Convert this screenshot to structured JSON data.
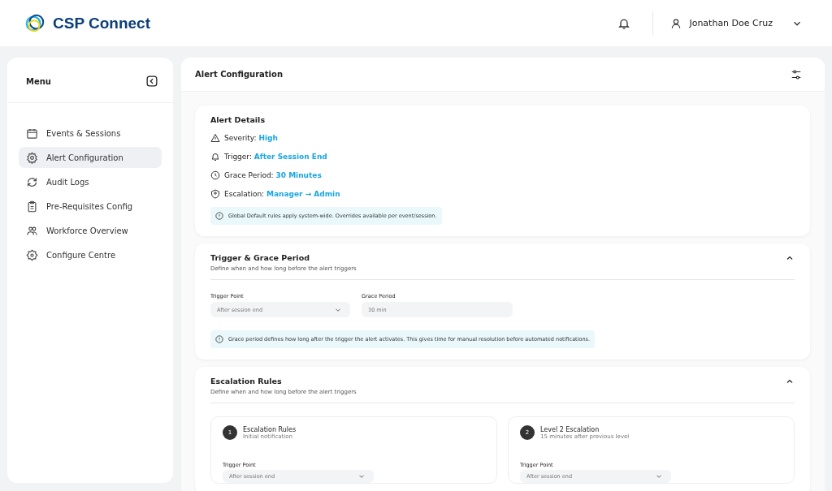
{
  "header": {
    "brand": "CSP Connect",
    "user": "Jonathan Doe Cruz"
  },
  "sidebar": {
    "title": "Menu",
    "items": [
      {
        "label": "Events & Sessions",
        "kind": "calendar",
        "selected": false
      },
      {
        "label": "Alert Configuration",
        "kind": "gear",
        "selected": true
      },
      {
        "label": "Audit Logs",
        "kind": "refresh",
        "selected": false
      },
      {
        "label": "Pre-Requisites Config",
        "kind": "clipboard",
        "selected": false
      },
      {
        "label": "Workforce Overview",
        "kind": "people",
        "selected": false
      },
      {
        "label": "Configure Centre",
        "kind": "badge",
        "selected": false
      }
    ]
  },
  "page": {
    "title": "Alert Configuration"
  },
  "alert_details": {
    "title": "Alert Details",
    "rows": [
      {
        "kind": "warning",
        "label": "Severity:",
        "value": "High"
      },
      {
        "kind": "bell",
        "label": "Trigger:",
        "value": "After Session End"
      },
      {
        "kind": "clock",
        "label": "Grace Period:",
        "value": "30 Minutes"
      },
      {
        "kind": "shield",
        "label": "Escalation:",
        "value": "Manager → Admin"
      }
    ],
    "note": "Global Default rules apply system-wide. Overrides available per event/session."
  },
  "trigger_section": {
    "title": "Trigger & Grace Period",
    "subtitle": "Define when and how long before the alert triggers",
    "expanded": true,
    "fields": [
      {
        "kind": "select",
        "label": "Trigger Point",
        "value": "After session end"
      },
      {
        "kind": "text",
        "label": "Grace Period",
        "value": "30 min"
      }
    ],
    "note": "Grace period defines how long after the trigger the alert activates. This gives time for manual resolution before automated notifications."
  },
  "escalation_section": {
    "title": "Escalation Rules",
    "subtitle": "Define when and how long before the alert triggers",
    "expanded": true,
    "levels": [
      {
        "number": "1",
        "title": "Escalation Rules",
        "subtitle": "Initial notification",
        "field_label": "Trigger Point",
        "field_value": "After session end"
      },
      {
        "number": "2",
        "title": "Level 2 Escalation",
        "subtitle": "15 minutes after previous level",
        "field_label": "Trigger Point",
        "field_value": "After session end"
      }
    ]
  }
}
